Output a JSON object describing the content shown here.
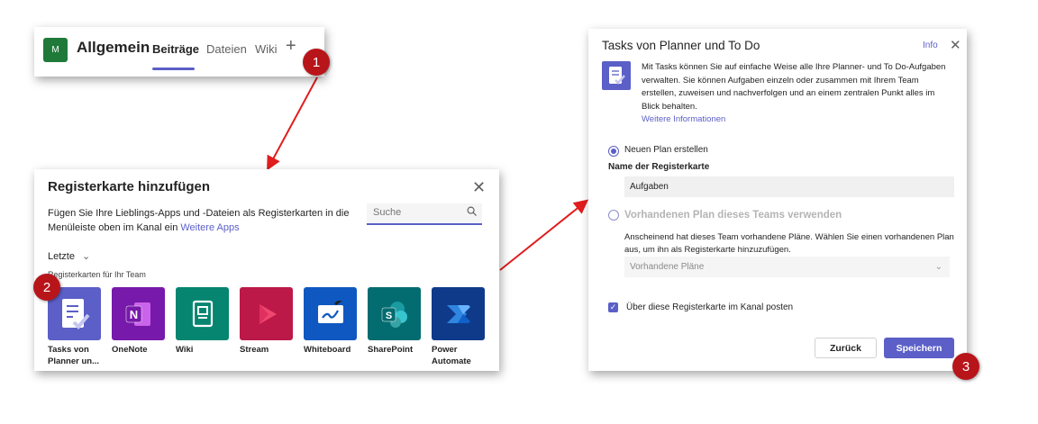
{
  "colors": {
    "accent": "#5b5fc7",
    "callout": "#b8151b",
    "arrow": "#e11d1d"
  },
  "callouts": [
    "1",
    "2",
    "3"
  ],
  "channel": {
    "avatar": "M",
    "name": "Allgemein",
    "tabs": [
      "Beiträge",
      "Dateien",
      "Wiki"
    ],
    "add_icon": "+"
  },
  "add_tab_dialog": {
    "title": "Registerkarte hinzufügen",
    "description": "Fügen Sie Ihre Lieblings-Apps und -Dateien als Registerkarten in die Menüleiste oben im Kanal ein",
    "more_apps_link": "Weitere Apps",
    "search_placeholder": "Suche",
    "recent_label": "Letzte",
    "section_label": "Registerkarten für Ihr Team",
    "apps": [
      {
        "label": "Tasks von Planner un...",
        "color": "#5b5fc7",
        "icon": "tasks-icon"
      },
      {
        "label": "OneNote",
        "color": "#7719aa",
        "icon": "onenote-icon"
      },
      {
        "label": "Wiki",
        "color": "#068570",
        "icon": "wiki-icon"
      },
      {
        "label": "Stream",
        "color": "#bc1948",
        "icon": "stream-icon"
      },
      {
        "label": "Whiteboard",
        "color": "#0f58c1",
        "icon": "whiteboard-icon"
      },
      {
        "label": "SharePoint",
        "color": "#036c70",
        "icon": "sharepoint-icon"
      },
      {
        "label": "Power Automate",
        "color": "#0f3a8a",
        "icon": "power-automate-icon"
      }
    ]
  },
  "tasks_dialog": {
    "title": "Tasks von Planner und To Do",
    "info_link": "Info",
    "intro": "Mit Tasks können Sie auf einfache Weise alle Ihre Planner- und To Do-Aufgaben verwalten. Sie können Aufgaben einzeln oder zusammen mit Ihrem Team erstellen, zuweisen und nachverfolgen und an einem zentralen Punkt alles im Blick behalten.",
    "more_info_link": "Weitere Informationen",
    "option_new_plan": "Neuen Plan erstellen",
    "tab_name_label": "Name der Registerkarte",
    "tab_name_value": "Aufgaben",
    "option_existing_plan": "Vorhandenen Plan dieses Teams verwenden",
    "existing_note": "Anscheinend hat dieses Team vorhandene Pläne. Wählen Sie einen vorhandenen Plan aus, um ihn als Registerkarte hinzuzufügen.",
    "existing_select": "Vorhandene Pläne",
    "post_checkbox_label": "Über diese Registerkarte im Kanal posten",
    "back_button": "Zurück",
    "save_button": "Speichern"
  }
}
